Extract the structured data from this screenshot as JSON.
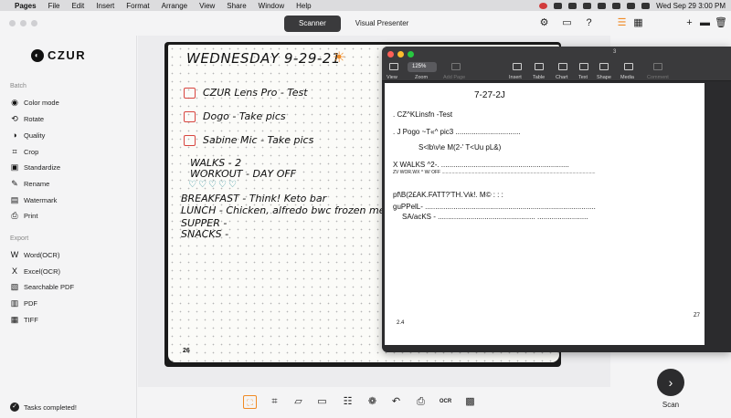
{
  "menubar": {
    "apple": "",
    "items": [
      "Pages",
      "File",
      "Edit",
      "Insert",
      "Format",
      "Arrange",
      "View",
      "Share",
      "Window",
      "Help"
    ],
    "clock": "Wed Sep 29  3:00 PM"
  },
  "czur": {
    "tabs": [
      {
        "label": "Scanner",
        "active": true
      },
      {
        "label": "Visual Presenter",
        "active": false
      }
    ],
    "logo": "CZUR",
    "sidebar": {
      "batch_label": "Batch",
      "batch_items": [
        {
          "label": "Color mode",
          "icon": "palette-icon"
        },
        {
          "label": "Rotate",
          "icon": "rotate-icon"
        },
        {
          "label": "Quality",
          "icon": "quality-icon"
        },
        {
          "label": "Crop",
          "icon": "crop-icon"
        },
        {
          "label": "Standardize",
          "icon": "standardize-icon"
        },
        {
          "label": "Rename",
          "icon": "rename-icon"
        },
        {
          "label": "Watermark",
          "icon": "watermark-icon"
        },
        {
          "label": "Print",
          "icon": "print-icon"
        }
      ],
      "export_label": "Export",
      "export_items": [
        {
          "label": "Word(OCR)",
          "icon": "word-icon"
        },
        {
          "label": "Excel(OCR)",
          "icon": "excel-icon"
        },
        {
          "label": "Searchable PDF",
          "icon": "searchable-pdf-icon"
        },
        {
          "label": "PDF",
          "icon": "pdf-icon"
        },
        {
          "label": "TIFF",
          "icon": "tiff-icon"
        }
      ],
      "status": "Tasks completed!"
    },
    "notebook": {
      "title": "WEDNESDAY 9-29-21",
      "lines": [
        "CZUR Lens Pro - Test",
        "Dogo - Take pics",
        "Sabine Mic - Take pics",
        "WALKS - 2",
        "WORKOUT - DAY OFF",
        "BREAKFAST - Think! Keto bar",
        "LUNCH - Chicken, alfredo bwc frozen meal",
        "SUPPER -",
        "SNACKS -"
      ],
      "page_left": "26",
      "page_right": "27"
    },
    "accent": "#f08a24",
    "scan_label": "Scan"
  },
  "pages_window": {
    "page_indicator": "3",
    "zoom": "125%",
    "zoom_label": "Zoom",
    "view_label": "View",
    "add_page_label": "Add Page",
    "toolbar": [
      "Insert",
      "Table",
      "Chart",
      "Text",
      "Shape",
      "Media",
      "Comment"
    ],
    "document": {
      "heading": "7-27-2J",
      "line1": ". CZ^KLinsfn -Test",
      "line2": ". J Pogo ~T«^ pic3 ................................",
      "line3": "S<lb\\v\\e M(2-' T<Uu pL&)",
      "line4": "X WALKS ^2-. ...............................................................",
      "line4b": "ZV WOR.WX ^ W/ OFF .........................................................................................................................",
      "line5": "pf\\B(2£AK.FATT?'TH.'v\\k!. M© : : :",
      "line6": "guPPelL- ....................................................................................",
      "line7": "SA/acKS - ................................................ .........................",
      "page_left": "2.4",
      "page_right": "Z7"
    }
  }
}
